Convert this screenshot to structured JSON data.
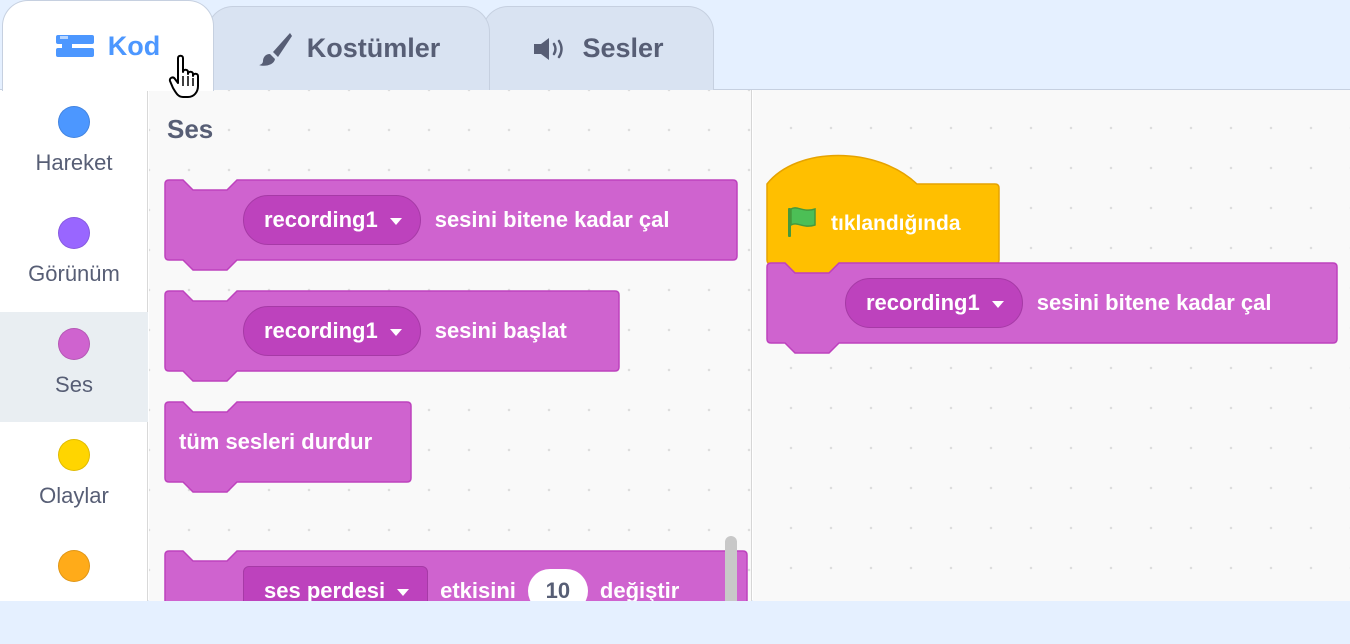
{
  "tabs": [
    {
      "label": "Kod",
      "icon": "code-icon",
      "active": true
    },
    {
      "label": "Kostümler",
      "icon": "paintbrush-icon",
      "active": false
    },
    {
      "label": "Sesler",
      "icon": "speaker-icon",
      "active": false
    }
  ],
  "categories": [
    {
      "label": "Hareket",
      "color": "#4c97ff"
    },
    {
      "label": "Görünüm",
      "color": "#9966ff"
    },
    {
      "label": "Ses",
      "color": "#cf63cf",
      "selected": true
    },
    {
      "label": "Olaylar",
      "color": "#ffd500"
    },
    {
      "label": "",
      "color": "#ffab19"
    }
  ],
  "palette": {
    "title": "Ses",
    "blocks": {
      "play_until_done": {
        "sound": "recording1",
        "text": "sesini bitene kadar çal"
      },
      "start_sound": {
        "sound": "recording1",
        "text": "sesini başlat"
      },
      "stop_all": {
        "text": "tüm sesleri durdur"
      },
      "change_effect": {
        "effect": "ses perdesi",
        "text1": "etkisini",
        "value": "10",
        "text2": "değiştir"
      }
    }
  },
  "workspace": {
    "hat_block": {
      "text": "tıklandığında",
      "icon": "green-flag-icon"
    },
    "play_block": {
      "sound": "recording1",
      "text": "sesini bitene kadar çal"
    }
  },
  "colors": {
    "sound": "#cf63cf",
    "sound_dark": "#bd42bd",
    "events": "#ffbf00",
    "tab_active": "#4c97ff"
  }
}
